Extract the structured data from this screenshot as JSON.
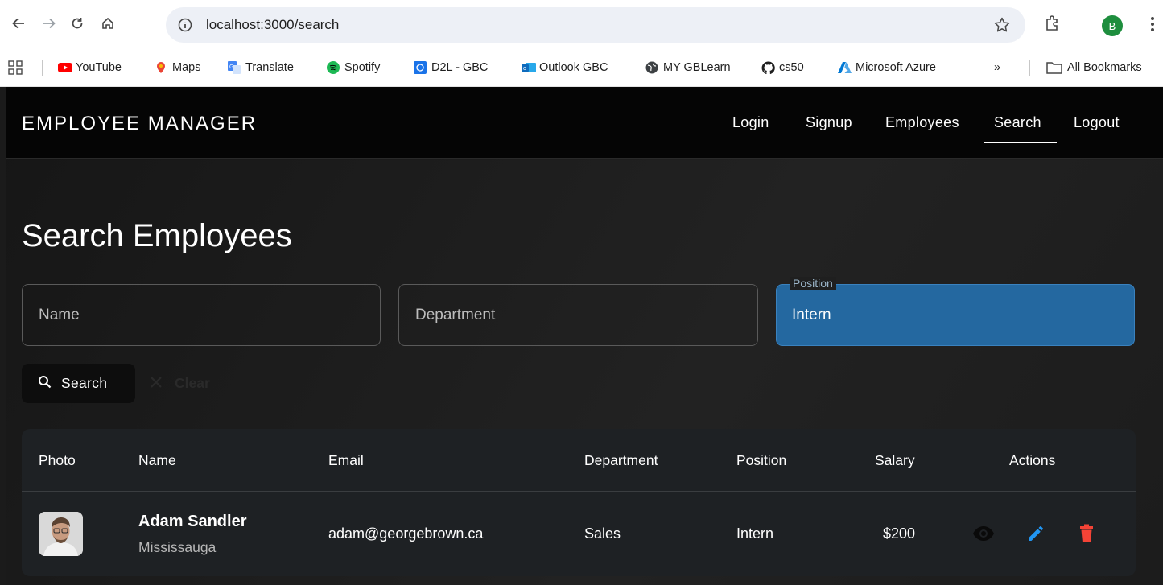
{
  "browser": {
    "url": "localhost:3000/search",
    "profile_initial": "B",
    "bookmarks": [
      {
        "label": "YouTube",
        "icon": "youtube-icon",
        "color": "#ff0000"
      },
      {
        "label": "Maps",
        "icon": "maps-icon",
        "color": "#34a853"
      },
      {
        "label": "Translate",
        "icon": "translate-icon",
        "color": "#4285f4"
      },
      {
        "label": "Spotify",
        "icon": "spotify-icon",
        "color": "#1db954"
      },
      {
        "label": "D2L - GBC",
        "icon": "d2l-icon",
        "color": "#1a73e8"
      },
      {
        "label": "Outlook GBC",
        "icon": "outlook-icon",
        "color": "#0f6cbd"
      },
      {
        "label": "MY GBLearn",
        "icon": "globe-icon",
        "color": "#3c4043"
      },
      {
        "label": "cs50",
        "icon": "github-icon",
        "color": "#1f1f1f"
      },
      {
        "label": "Microsoft Azure",
        "icon": "azure-icon",
        "color": "#0078d4"
      }
    ],
    "overflow_label": "»",
    "all_bookmarks_label": "All Bookmarks"
  },
  "appbar": {
    "brand": "EMPLOYEE MANAGER",
    "nav": [
      "Login",
      "Signup",
      "Employees",
      "Search",
      "Logout"
    ],
    "active_nav": "Search"
  },
  "page": {
    "title": "Search Employees"
  },
  "filters": {
    "name_placeholder": "Name",
    "department_placeholder": "Department",
    "position_label": "Position",
    "position_value": "Intern",
    "active_color": "#2468a0"
  },
  "buttons": {
    "search_label": "Search",
    "clear_label": "Clear"
  },
  "table": {
    "headers": [
      "Photo",
      "Name",
      "Email",
      "Department",
      "Position",
      "Salary",
      "Actions"
    ],
    "rows": [
      {
        "name": "Adam Sandler",
        "city": "Mississauga",
        "email": "adam@georgebrown.ca",
        "department": "Sales",
        "position": "Intern",
        "salary": "$200"
      }
    ],
    "action_icons": [
      "view-icon",
      "edit-icon",
      "delete-icon"
    ],
    "action_colors": {
      "view": "#0a0a0a",
      "edit": "#2196f3",
      "delete": "#f44336"
    }
  }
}
